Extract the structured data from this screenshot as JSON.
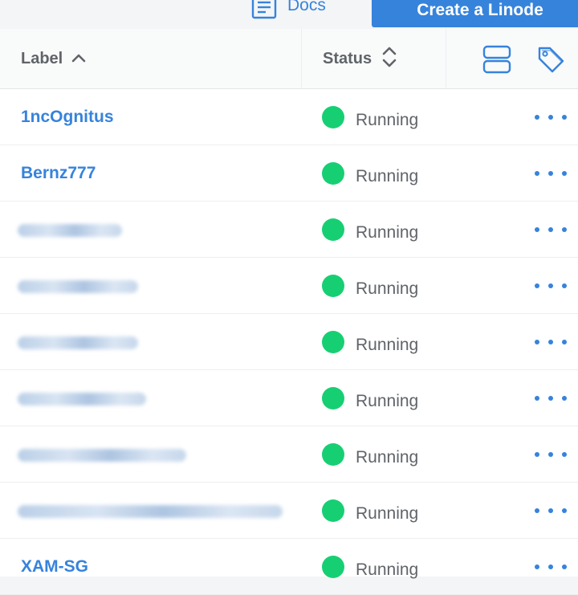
{
  "header": {
    "docs_label": "Docs",
    "create_label": "Create a Linode"
  },
  "table": {
    "columns": {
      "label": "Label",
      "status": "Status"
    },
    "rows": [
      {
        "label": "1ncOgnitus",
        "status": "Running"
      },
      {
        "label": "Bernz777",
        "status": "Running"
      },
      {
        "label": "",
        "status": "Running"
      },
      {
        "label": "",
        "status": "Running"
      },
      {
        "label": "",
        "status": "Running"
      },
      {
        "label": "",
        "status": "Running"
      },
      {
        "label": "",
        "status": "Running"
      },
      {
        "label": "",
        "status": "Running"
      },
      {
        "label": "XAM-SG",
        "status": "Running"
      }
    ]
  },
  "colors": {
    "accent": "#3683dc",
    "status_running": "#17cf73",
    "header_text": "#606469"
  },
  "icons": {
    "docs": "document-icon",
    "sort_asc": "chevron-up-icon",
    "sort_both": "sort-icon",
    "view_toggle": "list-view-icon",
    "tags": "tag-icon",
    "actions": "more-horizontal-icon"
  }
}
